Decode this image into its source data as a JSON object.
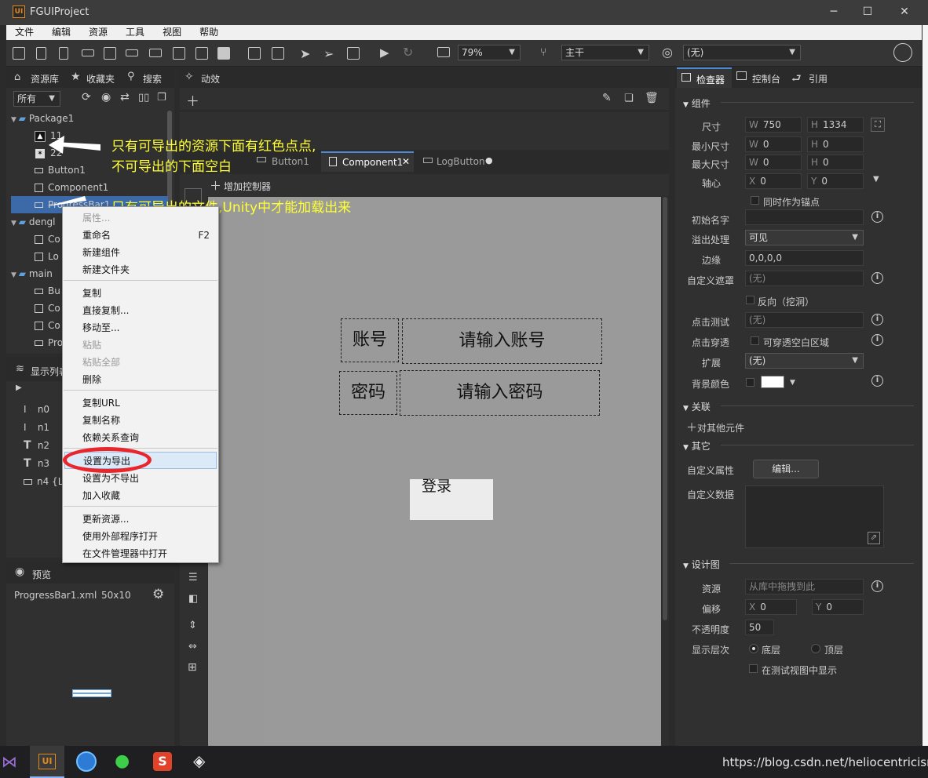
{
  "window": {
    "title": "FGUIProject",
    "logo_text": "UI",
    "minimize": "─",
    "maximize": "☐",
    "close": "✕"
  },
  "menu": [
    "文件",
    "编辑",
    "资源",
    "工具",
    "视图",
    "帮助"
  ],
  "toolbar": {
    "zoom": "79%",
    "branch": "主干",
    "language": "(无)"
  },
  "left_tabs": {
    "library": "资源库",
    "favorites": "收藏夹",
    "search": "搜索"
  },
  "library": {
    "filter": "所有",
    "tree": [
      {
        "label": "Package1"
      },
      {
        "label": "11"
      },
      {
        "label": "22"
      },
      {
        "label": "Button1"
      },
      {
        "label": "Component1"
      },
      {
        "label": "ProgressBar1"
      },
      {
        "label": "dengl"
      },
      {
        "label": "Co"
      },
      {
        "label": "Lo"
      },
      {
        "label": "main"
      },
      {
        "label": "Bu"
      },
      {
        "label": "Co"
      },
      {
        "label": "Co"
      },
      {
        "label": "Pro"
      }
    ]
  },
  "display_list": {
    "title": "显示列表",
    "items": [
      "n0",
      "n1",
      "n2",
      "n3",
      "n4 {L"
    ]
  },
  "preview": {
    "title": "预览",
    "file": "ProgressBar1.xml",
    "size": "50x10"
  },
  "anim_tab": "动效",
  "doc_tabs": [
    "Button1",
    "Component1",
    "LogButton"
  ],
  "add_controller": "增加控制器",
  "annotations": {
    "line1": "只有可导出的资源下面有红色点点,",
    "line2": "不可导出的下面空白",
    "line3": "只有可导出的文件,Unity中才能加载出来"
  },
  "context_menu": {
    "items": [
      {
        "label": "属性...",
        "disabled": true
      },
      {
        "label": "重命名",
        "shortcut": "F2"
      },
      {
        "label": "新建组件"
      },
      {
        "label": "新建文件夹"
      },
      {
        "label": "复制"
      },
      {
        "label": "直接复制..."
      },
      {
        "label": "移动至..."
      },
      {
        "label": "粘贴",
        "disabled": true
      },
      {
        "label": "粘贴全部",
        "disabled": true
      },
      {
        "label": "删除"
      },
      {
        "label": "复制URL"
      },
      {
        "label": "复制名称"
      },
      {
        "label": "依赖关系查询"
      },
      {
        "label": "设置为导出"
      },
      {
        "label": "设置为不导出"
      },
      {
        "label": "加入收藏"
      },
      {
        "label": "更新资源..."
      },
      {
        "label": "使用外部程序打开"
      },
      {
        "label": "在文件管理器中打开"
      }
    ],
    "highlight_color": "#e8262c"
  },
  "canvas": {
    "account_label": "账号",
    "account_input": "请输入账号",
    "password_label": "密码",
    "password_input": "请输入密码",
    "login_button": "登录"
  },
  "inspector": {
    "tabs": [
      "检查器",
      "控制台",
      "引用"
    ],
    "component_section": "组件",
    "size_label": "尺寸",
    "w": "750",
    "h": "1334",
    "min_size_label": "最小尺寸",
    "min_w": "0",
    "min_h": "0",
    "max_size_label": "最大尺寸",
    "max_w": "0",
    "max_h": "0",
    "pivot_label": "轴心",
    "pivot_x": "0",
    "pivot_y": "0",
    "as_anchor": "同时作为锚点",
    "init_name_label": "初始名字",
    "overflow_label": "溢出处理",
    "overflow_value": "可见",
    "margin_label": "边缘",
    "margin_value": "0,0,0,0",
    "mask_label": "自定义遮罩",
    "mask_value": "(无)",
    "reverse": "反向（挖洞）",
    "hit_test_label": "点击测试",
    "hit_test_value": "(无)",
    "pass_through_label": "点击穿透",
    "pass_through_option": "可穿透空白区域",
    "extend_label": "扩展",
    "extend_value": "(无)",
    "bg_color_label": "背景颜色",
    "bg_color": "#ffffff",
    "relation_section": "关联",
    "relation_add": "对其他元件",
    "other_section": "其它",
    "custom_prop_label": "自定义属性",
    "custom_prop_button": "编辑...",
    "custom_data_label": "自定义数据",
    "design_section": "设计图",
    "design_res_label": "资源",
    "design_res_placeholder": "从库中拖拽到此",
    "offset_label": "偏移",
    "offset_x": "0",
    "offset_y": "0",
    "opacity_label": "不透明度",
    "opacity_value": "50",
    "layer_label": "显示层次",
    "layer_bottom": "底层",
    "layer_top": "顶层",
    "show_in_test": "在测试视图中显示",
    "k_w": "W",
    "k_h": "H",
    "k_x": "X",
    "k_y": "Y"
  },
  "watermark": "https://blog.csdn.net/heliocentricism"
}
